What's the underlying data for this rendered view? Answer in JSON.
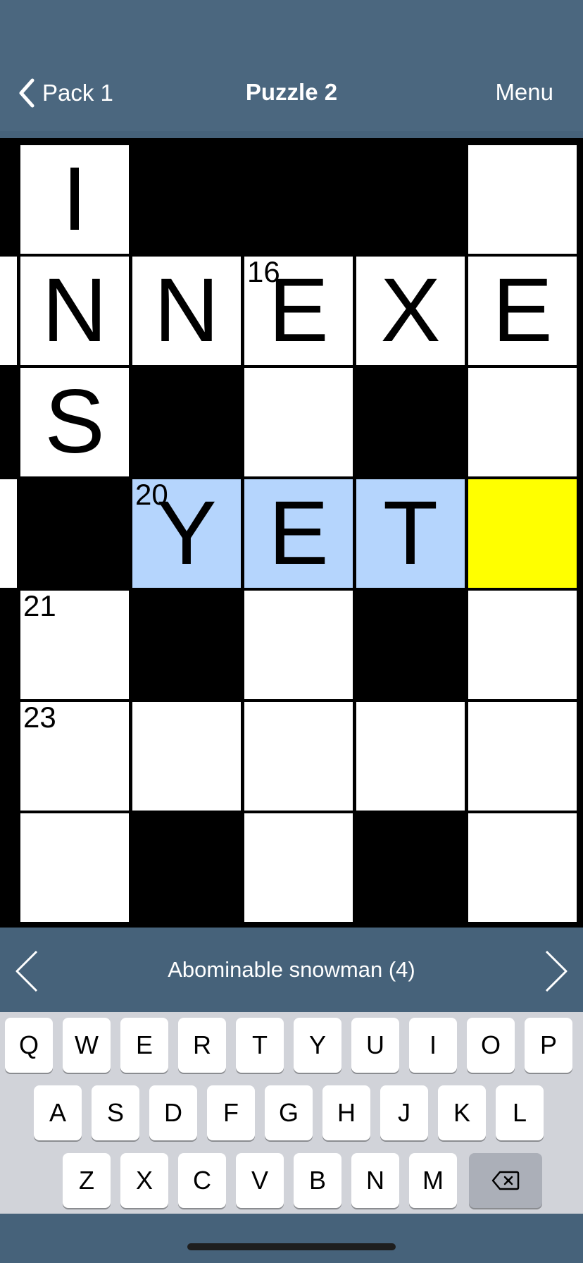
{
  "nav": {
    "back_label": "Pack 1",
    "title": "Puzzle 2",
    "menu_label": "Menu"
  },
  "grid": {
    "cells": [
      {
        "row": 0,
        "col": 0,
        "state": "black"
      },
      {
        "row": 0,
        "col": 1,
        "state": "white",
        "letter": "I"
      },
      {
        "row": 0,
        "col": 2,
        "state": "black"
      },
      {
        "row": 0,
        "col": 3,
        "state": "black"
      },
      {
        "row": 0,
        "col": 4,
        "state": "black"
      },
      {
        "row": 0,
        "col": 5,
        "state": "white"
      },
      {
        "row": 1,
        "col": 0,
        "state": "white"
      },
      {
        "row": 1,
        "col": 1,
        "state": "white",
        "letter": "N"
      },
      {
        "row": 1,
        "col": 2,
        "state": "white",
        "letter": "N"
      },
      {
        "row": 1,
        "col": 3,
        "state": "white",
        "letter": "E",
        "number": "16"
      },
      {
        "row": 1,
        "col": 4,
        "state": "white",
        "letter": "X"
      },
      {
        "row": 1,
        "col": 5,
        "state": "white",
        "letter": "E"
      },
      {
        "row": 2,
        "col": 0,
        "state": "black"
      },
      {
        "row": 2,
        "col": 1,
        "state": "white",
        "letter": "S"
      },
      {
        "row": 2,
        "col": 2,
        "state": "black"
      },
      {
        "row": 2,
        "col": 3,
        "state": "white"
      },
      {
        "row": 2,
        "col": 4,
        "state": "black"
      },
      {
        "row": 2,
        "col": 5,
        "state": "white"
      },
      {
        "row": 3,
        "col": 0,
        "state": "white"
      },
      {
        "row": 3,
        "col": 1,
        "state": "black"
      },
      {
        "row": 3,
        "col": 2,
        "state": "highlight",
        "letter": "Y",
        "number": "20"
      },
      {
        "row": 3,
        "col": 3,
        "state": "highlight",
        "letter": "E"
      },
      {
        "row": 3,
        "col": 4,
        "state": "highlight",
        "letter": "T"
      },
      {
        "row": 3,
        "col": 5,
        "state": "current"
      },
      {
        "row": 4,
        "col": 0,
        "state": "black"
      },
      {
        "row": 4,
        "col": 1,
        "state": "white",
        "number": "21"
      },
      {
        "row": 4,
        "col": 2,
        "state": "black"
      },
      {
        "row": 4,
        "col": 3,
        "state": "white"
      },
      {
        "row": 4,
        "col": 4,
        "state": "black"
      },
      {
        "row": 4,
        "col": 5,
        "state": "white"
      },
      {
        "row": 5,
        "col": 0,
        "state": "black"
      },
      {
        "row": 5,
        "col": 1,
        "state": "white",
        "number": "23"
      },
      {
        "row": 5,
        "col": 2,
        "state": "white"
      },
      {
        "row": 5,
        "col": 3,
        "state": "white"
      },
      {
        "row": 5,
        "col": 4,
        "state": "white"
      },
      {
        "row": 5,
        "col": 5,
        "state": "white"
      },
      {
        "row": 6,
        "col": 0,
        "state": "black"
      },
      {
        "row": 6,
        "col": 1,
        "state": "white"
      },
      {
        "row": 6,
        "col": 2,
        "state": "black"
      },
      {
        "row": 6,
        "col": 3,
        "state": "white"
      },
      {
        "row": 6,
        "col": 4,
        "state": "black"
      },
      {
        "row": 6,
        "col": 5,
        "state": "white"
      }
    ]
  },
  "clue": {
    "text": "Abominable snowman (4)",
    "prev_icon": "chevron-left-icon",
    "next_icon": "chevron-right-icon"
  },
  "keyboard": {
    "rows": [
      [
        "Q",
        "W",
        "E",
        "R",
        "T",
        "Y",
        "U",
        "I",
        "O",
        "P"
      ],
      [
        "A",
        "S",
        "D",
        "F",
        "G",
        "H",
        "J",
        "K",
        "L"
      ],
      [
        "Z",
        "X",
        "C",
        "V",
        "B",
        "N",
        "M"
      ]
    ],
    "backspace_icon": "backspace-icon"
  },
  "colors": {
    "nav_bg": "#4b677f",
    "highlight": "#b5d5fd",
    "current": "#ffff00",
    "keyboard_bg": "#d1d3d9"
  }
}
